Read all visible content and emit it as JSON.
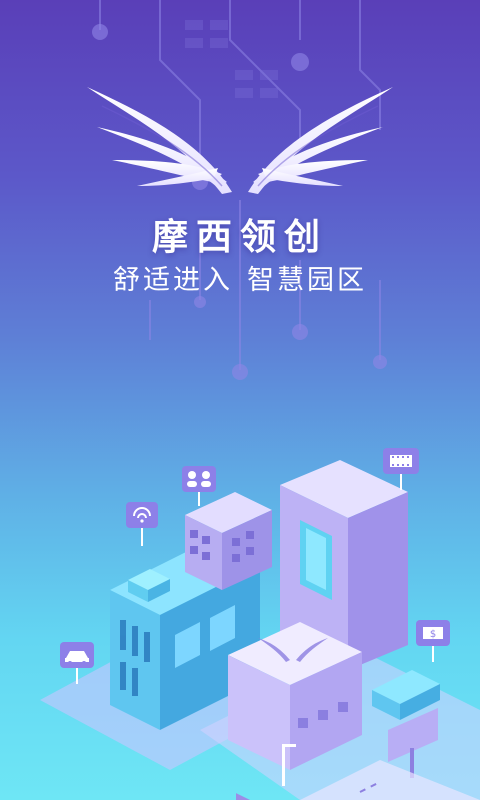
{
  "app": {
    "brand": "摩西领创",
    "slogan_part1": "舒适进入",
    "slogan_part2": "智慧园区"
  },
  "colors": {
    "top": "#5a3fb8",
    "bottom": "#6ee6f5",
    "accent": "#ffffff",
    "building_purple": "#9b8ef0",
    "building_cyan": "#5fc6f0"
  },
  "icons": {
    "logo": "wings-logo-icon",
    "people": "people-group-icon",
    "wifi": "wifi-icon",
    "film": "film-strip-icon",
    "car": "car-icon",
    "money": "dollar-bill-icon",
    "lamp": "street-lamp-icon",
    "billboard": "billboard-icon"
  },
  "billboard": {
    "symbol": "$"
  }
}
